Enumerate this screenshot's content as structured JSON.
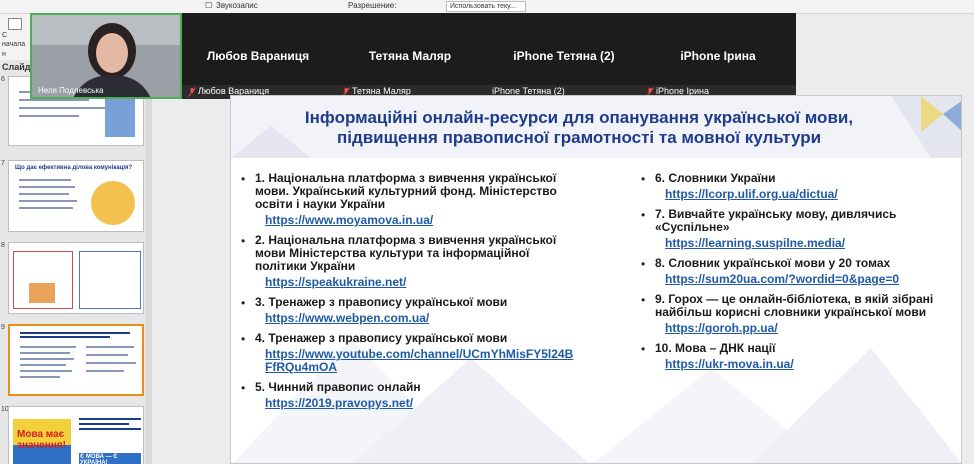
{
  "ribbon": {
    "record_audio": "Звукозапис",
    "resolution_label": "Разрешение:",
    "resolution_value": "Использовать теку..."
  },
  "left_tools": {
    "create_label": "С",
    "create_sub": "начала",
    "group": "н"
  },
  "slides_panel": {
    "title": "Слайды",
    "thumbnails": [
      {
        "number": "6",
        "title": "",
        "selected": false
      },
      {
        "number": "7",
        "title": "Що дає ефективна ділова комунікація?",
        "selected": false
      },
      {
        "number": "8",
        "title": "",
        "selected": false
      },
      {
        "number": "9",
        "title": "",
        "selected": true
      },
      {
        "number": "10",
        "title": "",
        "motto": "Мова має значення!",
        "slogan": "Є МОВА — Є УКРАЇНА!",
        "selected": false
      }
    ]
  },
  "video_call": {
    "self_name": "Неля Подлевська",
    "tiles": [
      {
        "name": "Любов Вараниця",
        "strip_label": "Любов Вараниця",
        "muted": true
      },
      {
        "name": "Тетяна Маляр",
        "strip_label": "Тетяна Маляр",
        "muted": true
      },
      {
        "name": "iPhone Тетяна (2)",
        "strip_label": "iPhone Тетяна (2)",
        "muted": false
      },
      {
        "name": "iPhone Ірина",
        "strip_label": "iPhone Ірина",
        "muted": true
      }
    ]
  },
  "slide": {
    "title_line1": "Інформаційні онлайн-ресурси для опанування української мови,",
    "title_line2": "підвищення правописної грамотності та мовної культури",
    "left_items": [
      {
        "text": "1. Національна платформа з вивчення української мови. Український культурний фонд. Міністерство освіти і науки України",
        "link": "https://www.moyamova.in.ua/"
      },
      {
        "text": "2. Національна платформа з вивчення української мови Міністерства культури та інформаційної політики України",
        "link": "https://speakukraine.net/"
      },
      {
        "text": "3. Тренажер з правопису української мови",
        "link": "https://www.webpen.com.ua/"
      },
      {
        "text": "4. Тренажер з правопису української мови",
        "link": "https://www.youtube.com/channel/UCmYhMisFY5l24BFfRQu4mOA"
      },
      {
        "text": "5. Чинний правопис онлайн",
        "link": "https://2019.pravopys.net/"
      }
    ],
    "right_items": [
      {
        "text": "6. Словники України",
        "link": "https://lcorp.ulif.org.ua/dictua/"
      },
      {
        "text": "7. Вивчайте українську мову, дивлячись «Суспільне»",
        "link": "https://learning.suspilne.media/"
      },
      {
        "text": "8. Словник української мови у 20 томах",
        "link": "https://sum20ua.com/?wordid=0&page=0"
      },
      {
        "text": "9. Горох — це онлайн-бібліотека, в якій зібрані найбільш корисні словники української мови",
        "link": "https://goroh.pp.ua/"
      },
      {
        "text": "10. Мова – ДНК нації",
        "link": "https://ukr-mova.in.ua/"
      }
    ]
  },
  "colors": {
    "title_blue": "#1f3c8a",
    "link_blue": "#1f5aa6",
    "selection_orange": "#e6901b",
    "self_border_green": "#4caf50"
  }
}
